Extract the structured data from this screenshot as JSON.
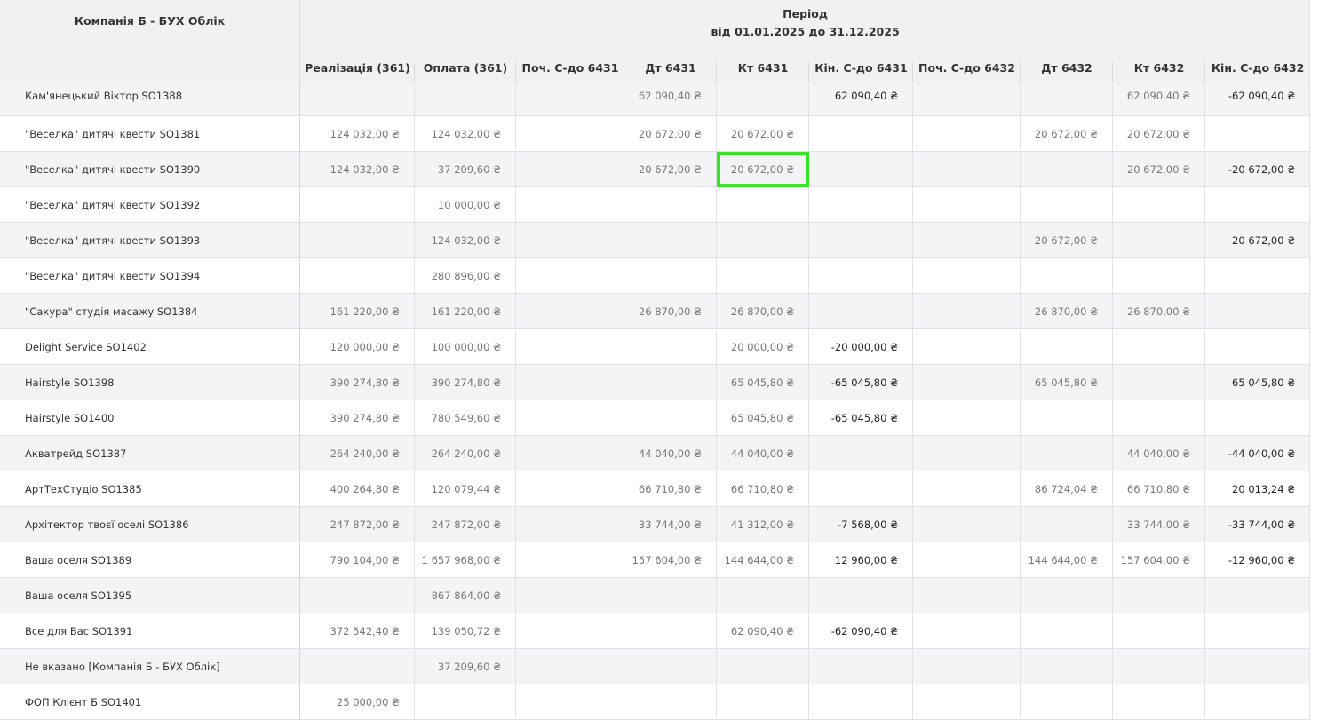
{
  "header": {
    "company": "Компанія Б - БУХ Облік",
    "period_title": "Період",
    "period_range": "від 01.01.2025 до 31.12.2025",
    "columns": [
      "Реалізація (361)",
      "Оплата (361)",
      "Поч. С-до 6431",
      "Дт 6431",
      "Кт 6431",
      "Кін. С-до 6431",
      "Поч. С-до 6432",
      "Дт 6432",
      "Кт 6432",
      "Кін. С-до 6432"
    ]
  },
  "rows": [
    {
      "name": "Кам'янецький Віктор SO1388",
      "cells": [
        "",
        "",
        "",
        "62 090,40 ₴",
        "",
        "62 090,40 ₴",
        "",
        "",
        "62 090,40 ₴",
        "-62 090,40 ₴"
      ]
    },
    {
      "name": "\"Веселка\" дитячі квести SO1381",
      "cells": [
        "124 032,00 ₴",
        "124 032,00 ₴",
        "",
        "20 672,00 ₴",
        "20 672,00 ₴",
        "",
        "",
        "20 672,00 ₴",
        "20 672,00 ₴",
        ""
      ]
    },
    {
      "name": "\"Веселка\" дитячі квести SO1390",
      "cells": [
        "124 032,00 ₴",
        "37 209,60 ₴",
        "",
        "20 672,00 ₴",
        "20 672,00 ₴",
        "",
        "",
        "",
        "20 672,00 ₴",
        "-20 672,00 ₴"
      ]
    },
    {
      "name": "\"Веселка\" дитячі квести SO1392",
      "cells": [
        "",
        "10 000,00 ₴",
        "",
        "",
        "",
        "",
        "",
        "",
        "",
        ""
      ]
    },
    {
      "name": "\"Веселка\" дитячі квести SO1393",
      "cells": [
        "",
        "124 032,00 ₴",
        "",
        "",
        "",
        "",
        "",
        "20 672,00 ₴",
        "",
        "20 672,00 ₴"
      ]
    },
    {
      "name": "\"Веселка\" дитячі квести SO1394",
      "cells": [
        "",
        "280 896,00 ₴",
        "",
        "",
        "",
        "",
        "",
        "",
        "",
        ""
      ]
    },
    {
      "name": "\"Сакура\" студія масажу SO1384",
      "cells": [
        "161 220,00 ₴",
        "161 220,00 ₴",
        "",
        "26 870,00 ₴",
        "26 870,00 ₴",
        "",
        "",
        "26 870,00 ₴",
        "26 870,00 ₴",
        ""
      ]
    },
    {
      "name": "Delight Service SO1402",
      "cells": [
        "120 000,00 ₴",
        "100 000,00 ₴",
        "",
        "",
        "20 000,00 ₴",
        "-20 000,00 ₴",
        "",
        "",
        "",
        ""
      ]
    },
    {
      "name": "Hairstyle SO1398",
      "cells": [
        "390 274,80 ₴",
        "390 274,80 ₴",
        "",
        "",
        "65 045,80 ₴",
        "-65 045,80 ₴",
        "",
        "65 045,80 ₴",
        "",
        "65 045,80 ₴"
      ]
    },
    {
      "name": "Hairstyle SO1400",
      "cells": [
        "390 274,80 ₴",
        "780 549,60 ₴",
        "",
        "",
        "65 045,80 ₴",
        "-65 045,80 ₴",
        "",
        "",
        "",
        ""
      ]
    },
    {
      "name": "Акватрейд SO1387",
      "cells": [
        "264 240,00 ₴",
        "264 240,00 ₴",
        "",
        "44 040,00 ₴",
        "44 040,00 ₴",
        "",
        "",
        "",
        "44 040,00 ₴",
        "-44 040,00 ₴"
      ]
    },
    {
      "name": "АртТехСтудіо SO1385",
      "cells": [
        "400 264,80 ₴",
        "120 079,44 ₴",
        "",
        "66 710,80 ₴",
        "66 710,80 ₴",
        "",
        "",
        "86 724,04 ₴",
        "66 710,80 ₴",
        "20 013,24 ₴"
      ]
    },
    {
      "name": "Архітектор твоєї оселі SO1386",
      "cells": [
        "247 872,00 ₴",
        "247 872,00 ₴",
        "",
        "33 744,00 ₴",
        "41 312,00 ₴",
        "-7 568,00 ₴",
        "",
        "",
        "33 744,00 ₴",
        "-33 744,00 ₴"
      ]
    },
    {
      "name": "Ваша оселя SO1389",
      "cells": [
        "790 104,00 ₴",
        "1 657 968,00 ₴",
        "",
        "157 604,00 ₴",
        "144 644,00 ₴",
        "12 960,00 ₴",
        "",
        "144 644,00 ₴",
        "157 604,00 ₴",
        "-12 960,00 ₴"
      ]
    },
    {
      "name": "Ваша оселя SO1395",
      "cells": [
        "",
        "867 864,00 ₴",
        "",
        "",
        "",
        "",
        "",
        "",
        "",
        ""
      ]
    },
    {
      "name": "Все для Вас SO1391",
      "cells": [
        "372 542,40 ₴",
        "139 050,72 ₴",
        "",
        "",
        "62 090,40 ₴",
        "-62 090,40 ₴",
        "",
        "",
        "",
        ""
      ]
    },
    {
      "name": "Не вказано [Компанія Б - БУХ Облік]",
      "cells": [
        "",
        "37 209,60 ₴",
        "",
        "",
        "",
        "",
        "",
        "",
        "",
        ""
      ]
    },
    {
      "name": "ФОП Клієнт Б SO1401",
      "cells": [
        "25 000,00 ₴",
        "",
        "",
        "",
        "",
        "",
        "",
        "",
        "",
        ""
      ]
    }
  ],
  "highlight_color": "#3ae22a"
}
